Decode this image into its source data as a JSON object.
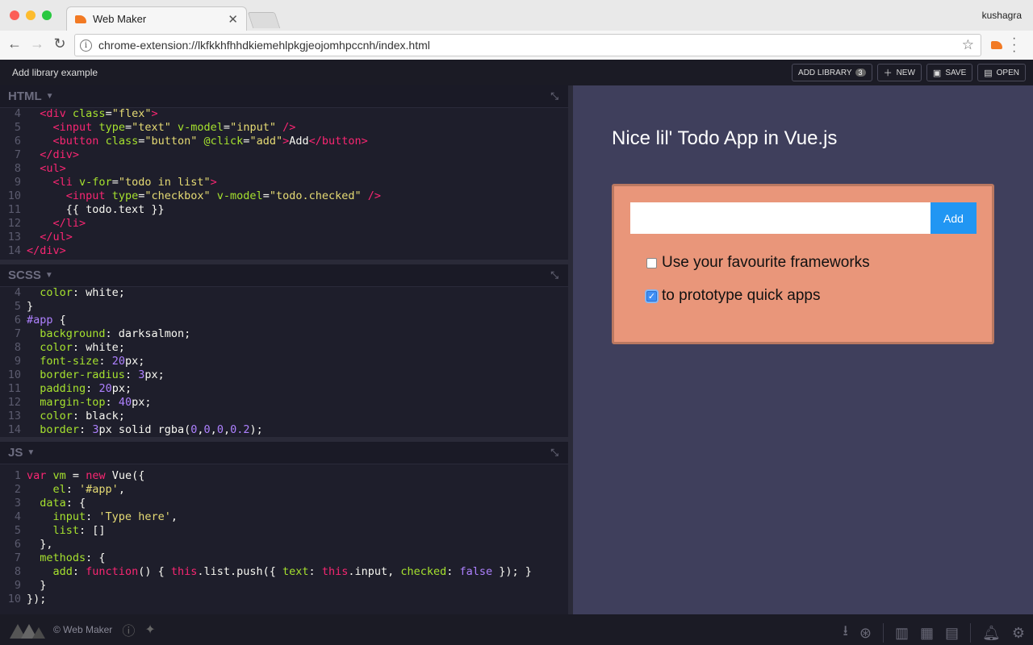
{
  "browser": {
    "tab_title": "Web Maker",
    "user": "kushagra",
    "url": "chrome-extension://lkfkkhfhhdkiemehlpkgjeojomhpccnh/index.html"
  },
  "header": {
    "project_title": "Add library example",
    "add_library_label": "ADD LIBRARY",
    "library_count": "3",
    "new_label": "NEW",
    "save_label": "SAVE",
    "open_label": "OPEN"
  },
  "panes": {
    "html_label": "HTML",
    "css_label": "SCSS",
    "js_label": "JS"
  },
  "preview": {
    "heading": "Nice lil' Todo App in Vue.js",
    "add_button": "Add",
    "todos": [
      {
        "text": "Use your favourite frameworks",
        "checked": false
      },
      {
        "text": "to prototype quick apps",
        "checked": true
      }
    ]
  },
  "footer": {
    "copyright": "© Web Maker"
  },
  "colors": {
    "salmon": "#e9967a",
    "preview_bg": "#3f3f5c",
    "add_blue": "#2196f3"
  }
}
